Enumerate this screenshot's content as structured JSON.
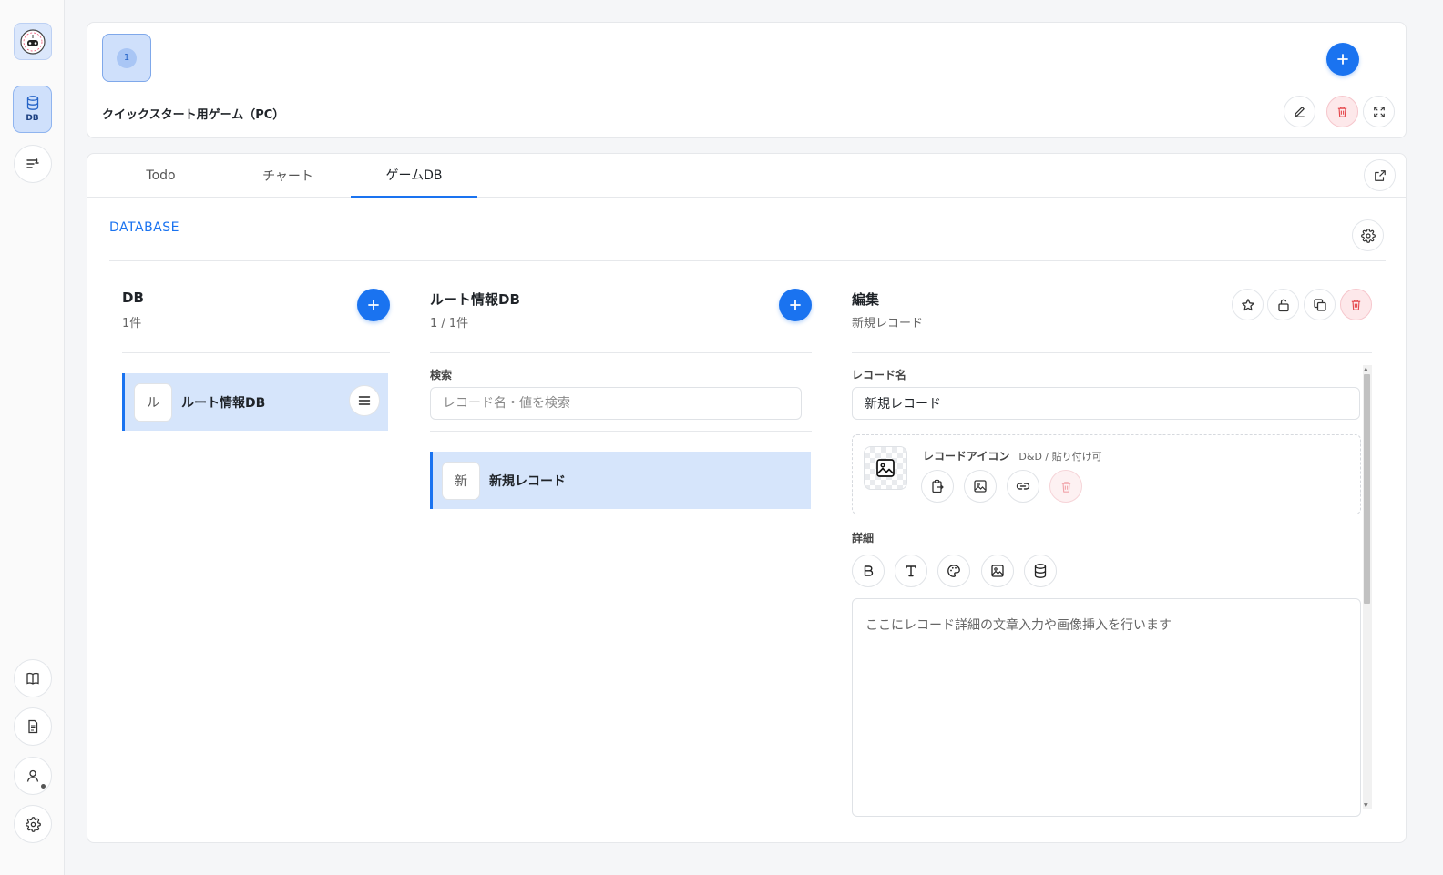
{
  "rail": {
    "db_label": "DB"
  },
  "game": {
    "thumb_number": "1",
    "title": "クイックスタート用ゲーム（PC）"
  },
  "tabs": [
    {
      "label": "Todo",
      "active": false
    },
    {
      "label": "チャート",
      "active": false
    },
    {
      "label": "ゲームDB",
      "active": true
    }
  ],
  "section_label": "DATABASE",
  "db_column": {
    "title": "DB",
    "count": "1件",
    "items": [
      {
        "avatar": "ル",
        "label": "ルート情報DB"
      }
    ]
  },
  "record_column": {
    "title": "ルート情報DB",
    "count": "1 / 1件",
    "search_label": "検索",
    "search_placeholder": "レコード名・値を検索",
    "items": [
      {
        "avatar": "新",
        "label": "新規レコード"
      }
    ]
  },
  "edit_column": {
    "title": "編集",
    "subtitle": "新規レコード",
    "record_name_label": "レコード名",
    "record_name_value": "新規レコード",
    "record_icon_label": "レコードアイコン",
    "record_icon_hint": "D&D / 貼り付け可",
    "detail_label": "詳細",
    "detail_placeholder": "ここにレコード詳細の文章入力や画像挿入を行います"
  },
  "colors": {
    "accent": "#1a73f0",
    "selected_bg": "#d6e5fb",
    "danger": "#e5484d"
  }
}
